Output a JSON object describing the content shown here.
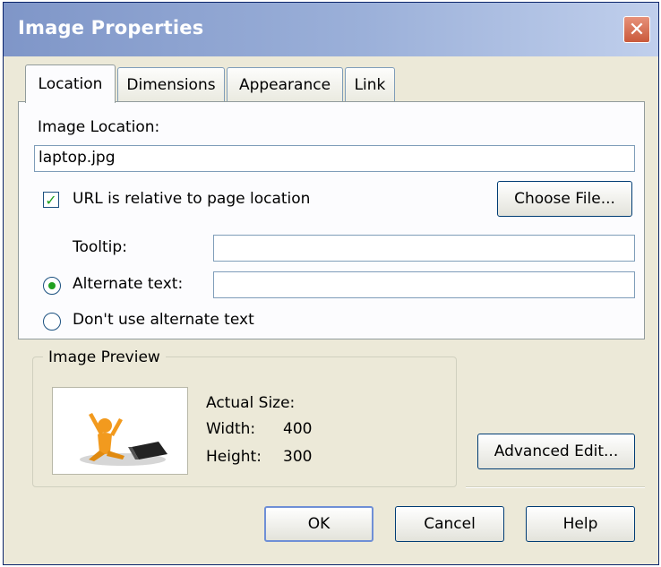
{
  "dialog": {
    "title": "Image Properties",
    "close_glyph": "✕"
  },
  "tabs": [
    {
      "label": "Location",
      "active": true
    },
    {
      "label": "Dimensions",
      "active": false
    },
    {
      "label": "Appearance",
      "active": false
    },
    {
      "label": "Link",
      "active": false
    }
  ],
  "location": {
    "image_location_label": "Image Location:",
    "image_location_value": "laptop.jpg",
    "relative_url_label": "URL is relative to page location",
    "relative_url_checked": true,
    "choose_file_label": "Choose File...",
    "tooltip_label": "Tooltip:",
    "tooltip_value": "",
    "alt_text_label": "Alternate text:",
    "alt_text_value": "",
    "alt_text_selected": true,
    "no_alt_label": "Don't use alternate text"
  },
  "preview": {
    "group_title": "Image Preview",
    "actual_size_label": "Actual Size:",
    "width_label": "Width:",
    "width_value": "400",
    "height_label": "Height:",
    "height_value": "300",
    "image_icon": "figure-with-laptop-icon"
  },
  "buttons": {
    "advanced_edit": "Advanced Edit...",
    "ok": "OK",
    "cancel": "Cancel",
    "help": "Help"
  },
  "colors": {
    "titlebar": "#7f96c8",
    "dialog_bg": "#ece9d8",
    "close": "#c9593b",
    "check_green": "#21a121"
  }
}
